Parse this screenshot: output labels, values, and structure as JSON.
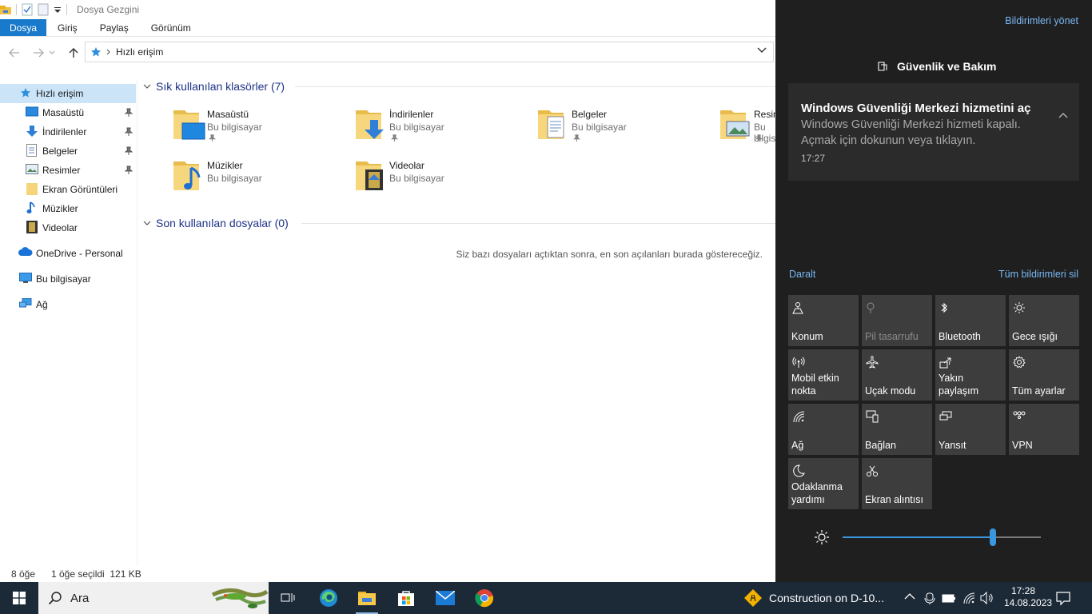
{
  "explorer": {
    "title": "Dosya Gezgini",
    "ribbon_tabs": [
      "Dosya",
      "Giriş",
      "Paylaş",
      "Görünüm"
    ],
    "address": "Hızlı erişim",
    "sidebar": [
      {
        "label": "Hızlı erişim",
        "icon": "star-icon",
        "selected": true
      },
      {
        "label": "Masaüstü",
        "icon": "desktop-folder-icon",
        "pinned": true
      },
      {
        "label": "İndirilenler",
        "icon": "download-arrow-icon",
        "pinned": true
      },
      {
        "label": "Belgeler",
        "icon": "document-icon",
        "pinned": true
      },
      {
        "label": "Resimler",
        "icon": "pictures-icon",
        "pinned": true
      },
      {
        "label": "Ekran Görüntüleri",
        "icon": "folder-icon"
      },
      {
        "label": "Müzikler",
        "icon": "music-note-icon"
      },
      {
        "label": "Videolar",
        "icon": "film-icon"
      },
      {
        "label": "OneDrive - Personal",
        "icon": "cloud-icon"
      },
      {
        "label": "Bu bilgisayar",
        "icon": "computer-icon"
      },
      {
        "label": "Ağ",
        "icon": "network-icon"
      }
    ],
    "frequent_header": "Sık kullanılan klasörler (7)",
    "folders": [
      {
        "name": "Masaüstü",
        "location": "Bu bilgisayar",
        "pinned": true
      },
      {
        "name": "İndirilenler",
        "location": "Bu bilgisayar",
        "pinned": true
      },
      {
        "name": "Belgeler",
        "location": "Bu bilgisayar",
        "pinned": true
      },
      {
        "name": "Resimler",
        "location": "Bu bilgisayar",
        "pinned": true
      },
      {
        "name": "Müzikler",
        "location": "Bu bilgisayar",
        "pinned": false
      },
      {
        "name": "Videolar",
        "location": "Bu bilgisayar",
        "pinned": false
      }
    ],
    "recent_header": "Son kullanılan dosyalar (0)",
    "recent_empty": "Siz bazı dosyaları açtıktan sonra, en son açılanları burada göstereceğiz.",
    "status": {
      "count": "8 öğe",
      "selection": "1 öğe seçildi  121 KB"
    }
  },
  "action_center": {
    "manage": "Bildirimleri yönet",
    "app_name": "Güvenlik ve Bakım",
    "notification": {
      "title": "Windows Güvenliği Merkezi hizmetini aç",
      "body": "Windows Güvenliği Merkezi hizmeti kapalı. Açmak için dokunun veya tıklayın.",
      "time": "17:27"
    },
    "collapse": "Daralt",
    "clear_all": "Tüm bildirimleri sil",
    "tiles": [
      {
        "label": "Konum",
        "icon": "location-icon"
      },
      {
        "label": "Pil tasarrufu",
        "icon": "battery-saver-icon",
        "disabled": true
      },
      {
        "label": "Bluetooth",
        "icon": "bluetooth-icon"
      },
      {
        "label": "Gece ışığı",
        "icon": "sun-icon"
      },
      {
        "label": "Mobil etkin nokta",
        "icon": "hotspot-icon"
      },
      {
        "label": "Uçak modu",
        "icon": "airplane-icon"
      },
      {
        "label": "Yakın paylaşım",
        "icon": "share-icon"
      },
      {
        "label": "Tüm ayarlar",
        "icon": "gear-icon"
      },
      {
        "label": "Ağ",
        "icon": "wifi-icon"
      },
      {
        "label": "Bağlan",
        "icon": "connect-icon"
      },
      {
        "label": "Yansıt",
        "icon": "project-icon"
      },
      {
        "label": "VPN",
        "icon": "vpn-icon"
      },
      {
        "label": "Odaklanma yardımı",
        "icon": "moon-icon"
      },
      {
        "label": "Ekran alıntısı",
        "icon": "snip-icon"
      }
    ],
    "brightness_level": 0.76
  },
  "taskbar": {
    "search_placeholder": "Ara",
    "weather_text": "Construction on D-10...",
    "time": "17:28",
    "date": "14.08.2023"
  }
}
